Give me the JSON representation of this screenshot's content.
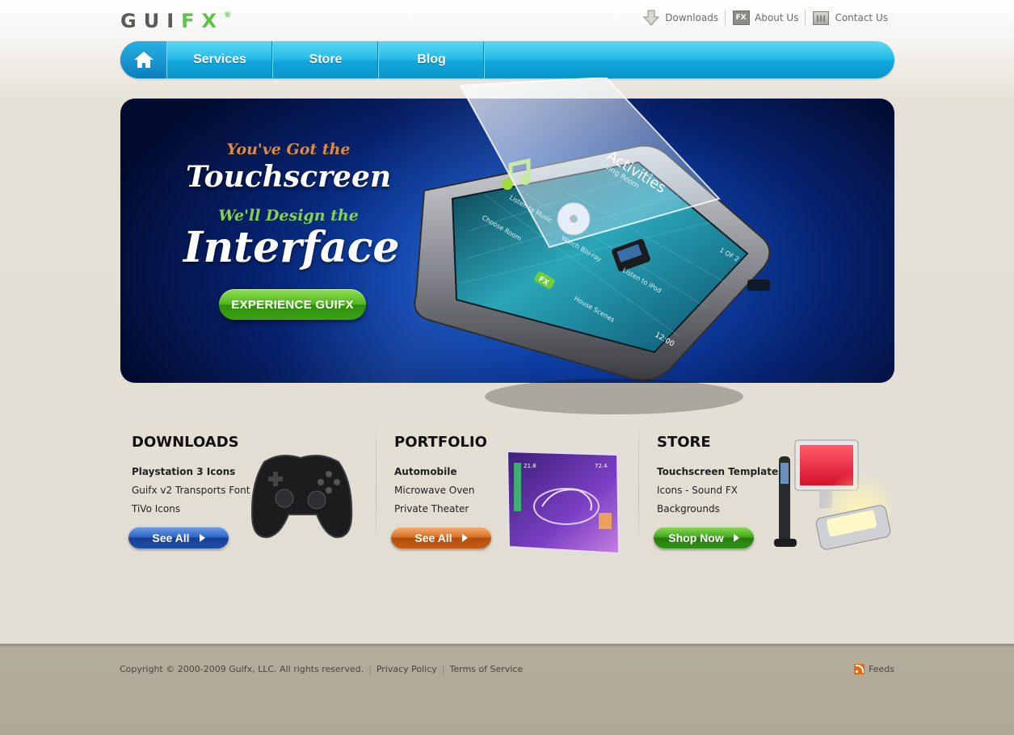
{
  "logo": {
    "gui": "GUI",
    "fx": "FX",
    "reg": "®"
  },
  "toplinks": [
    {
      "label": "Downloads",
      "icon": "download-arrow-icon"
    },
    {
      "label": "About Us",
      "icon": "fx-box-icon"
    },
    {
      "label": "Contact Us",
      "icon": "fax-phone-icon"
    }
  ],
  "nav": {
    "home_icon": "home-icon",
    "items": [
      {
        "label": "Services"
      },
      {
        "label": "Store"
      },
      {
        "label": "Blog"
      }
    ]
  },
  "hero": {
    "line1": "You've Got the",
    "line2": "Touchscreen",
    "line3": "We'll Design the",
    "line4": "Interface",
    "cta": "EXPERIENCE GUIFX",
    "tablet": {
      "title": "Activities",
      "subtitle": "Living Room",
      "listen_music": "Listen to Music",
      "watch_bluray": "Watch Blu-ray",
      "listen_ipod": "Listen to iPod",
      "page": "1 OF 2",
      "time": "12:00",
      "scenes": "House Scenes",
      "choose_room": "Choose Room",
      "fx": "FX"
    }
  },
  "sections": [
    {
      "title": "DOWNLOADS",
      "items": [
        "Playstation 3 Icons",
        "Guifx v2 Transports Font",
        "TiVo Icons"
      ],
      "button": "See All",
      "art": "gamepad-image"
    },
    {
      "title": "PORTFOLIO",
      "items": [
        "Automobile",
        "Microwave Oven",
        "Private Theater"
      ],
      "button": "See All",
      "art": "car-ui-screen-image"
    },
    {
      "title": "STORE",
      "items": [
        "Touchscreen Templates",
        "Icons - Sound FX",
        "Backgrounds"
      ],
      "button": "Shop Now",
      "art": "devices-image"
    }
  ],
  "footer": {
    "copyright": "Copyright © 2000-2009 Guifx, LLC. All rights reserved.",
    "privacy": "Privacy Policy",
    "terms": "Terms of Service",
    "feeds": "Feeds"
  },
  "colors": {
    "accent_blue": "#1fb3e6",
    "brand_green": "#5fc34a",
    "hero_dark": "#06206a"
  }
}
